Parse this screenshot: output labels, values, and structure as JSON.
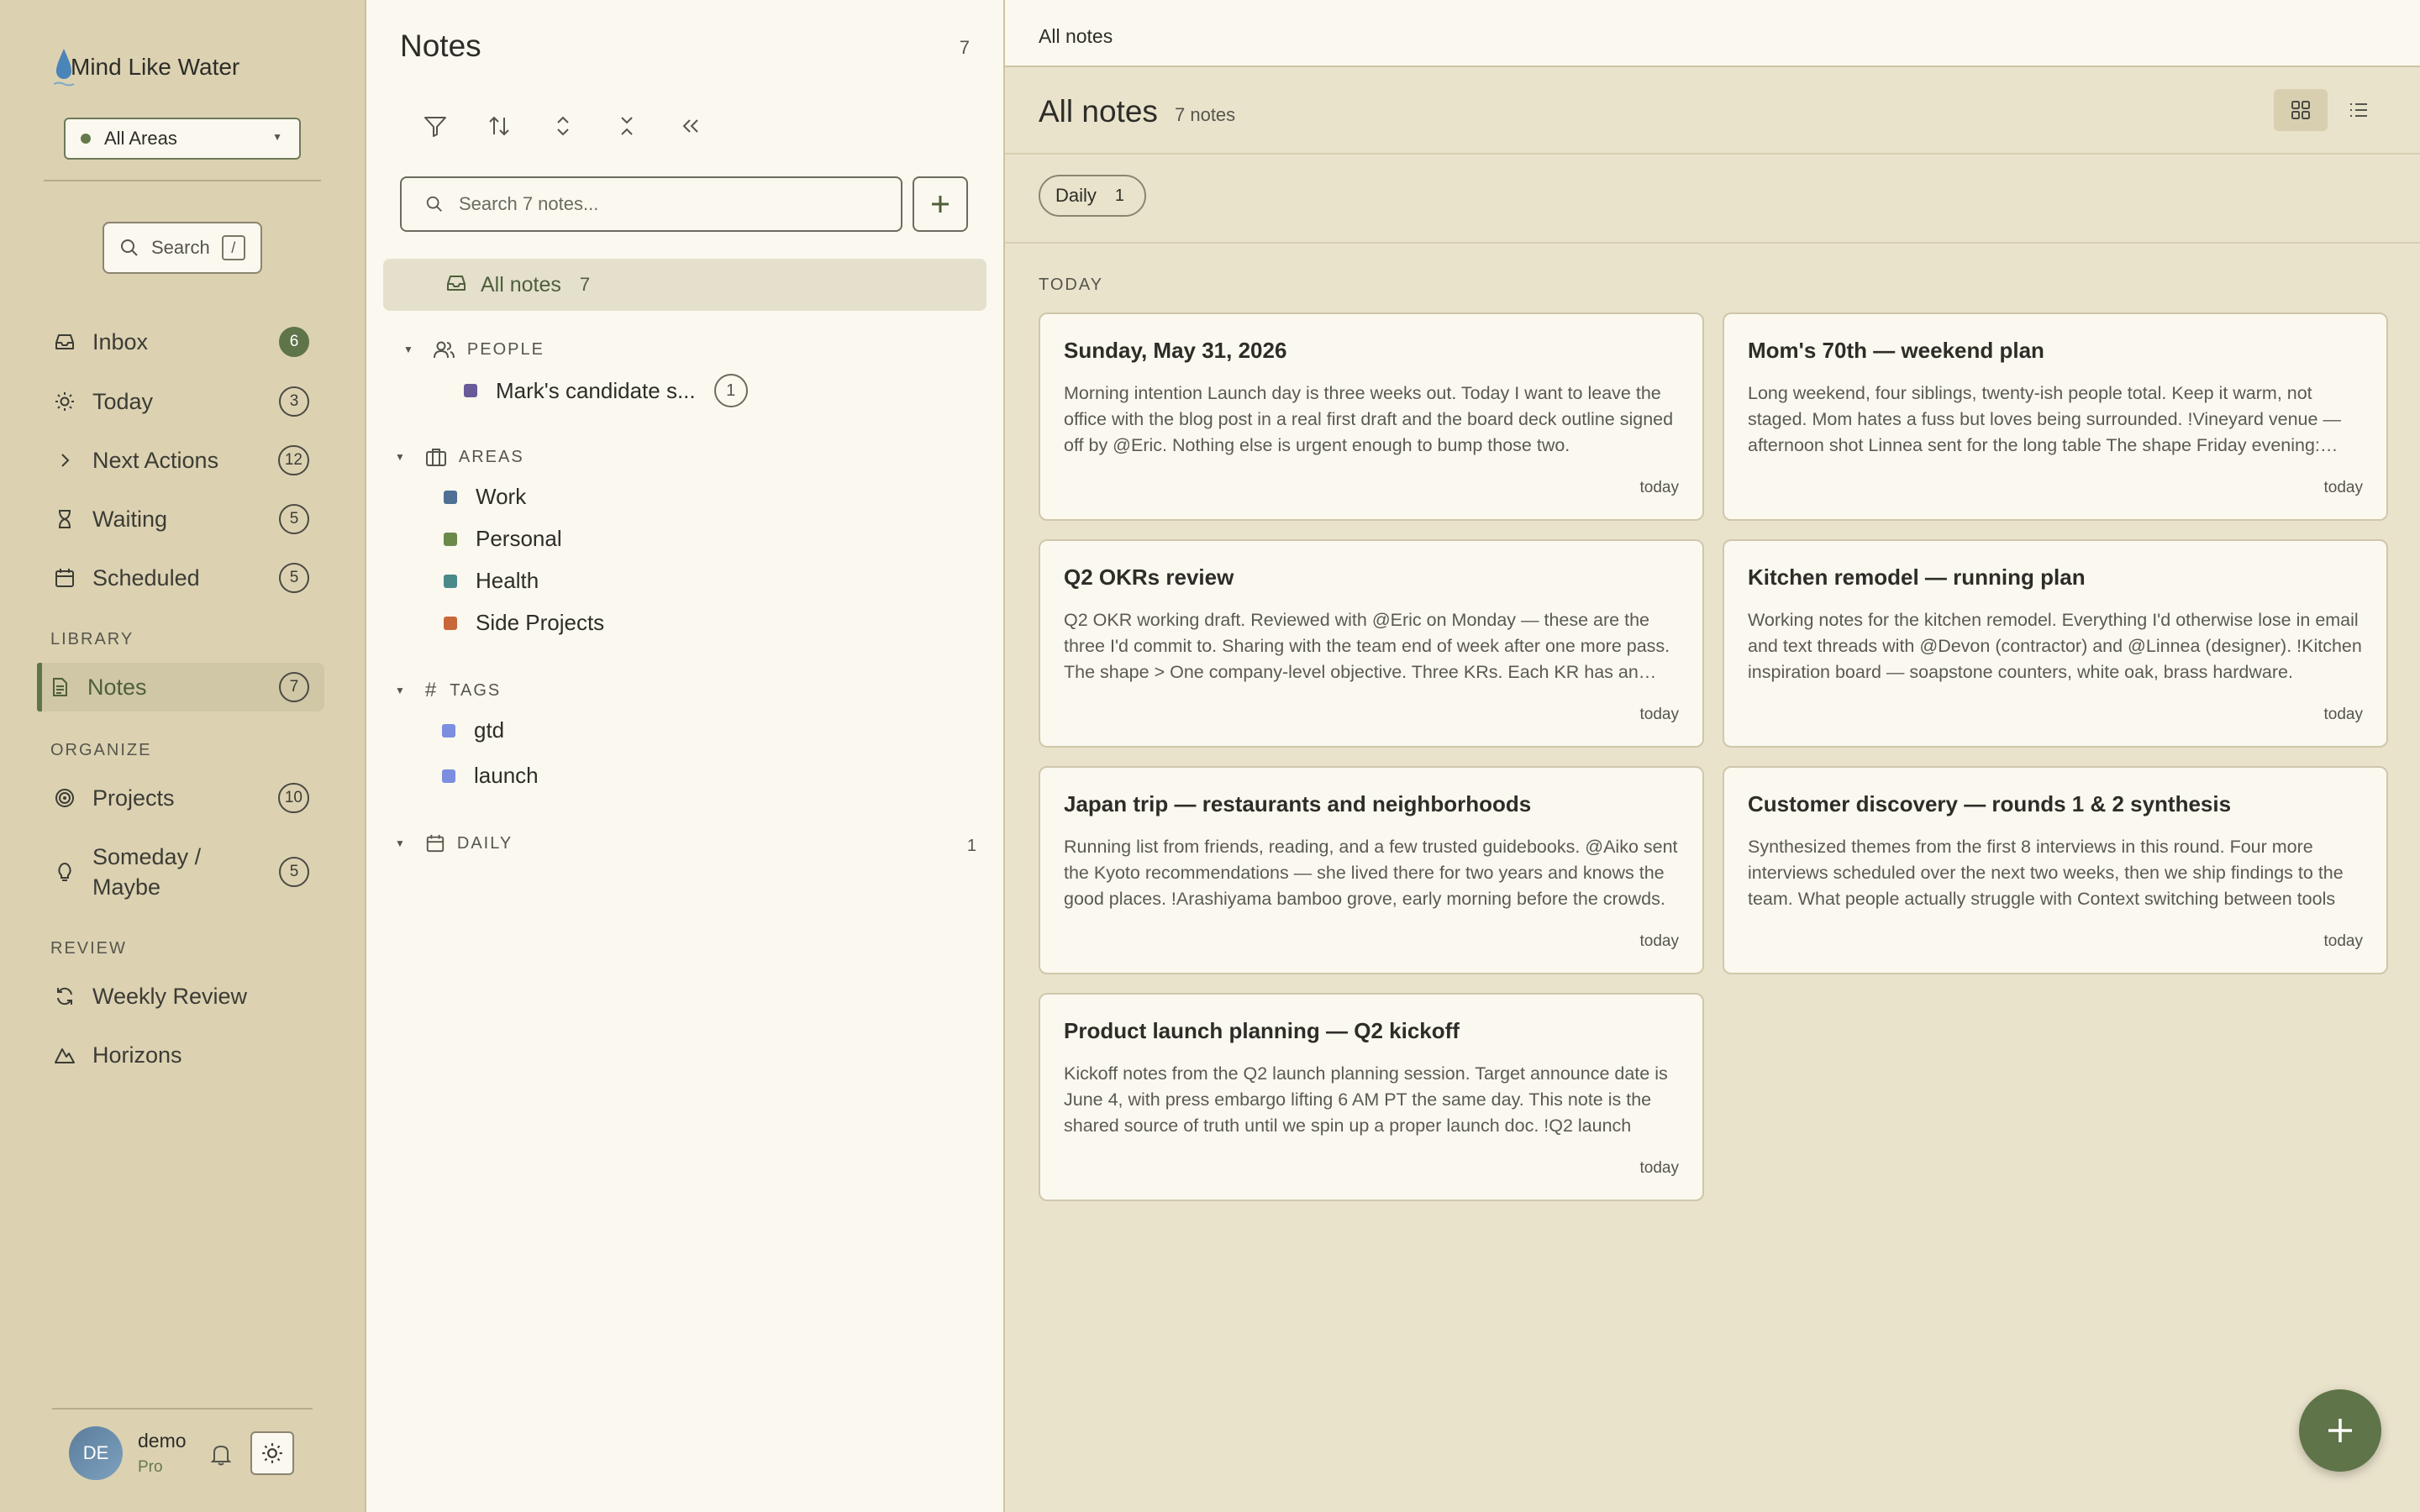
{
  "app": {
    "name": "Mind Like Water",
    "area_select": "All Areas",
    "search_label": "Search",
    "search_shortcut": "/",
    "accent_color": "#5f7448"
  },
  "sidebar": {
    "nav": [
      {
        "label": "Inbox",
        "count": "6",
        "icon": "inbox-icon"
      },
      {
        "label": "Today",
        "count": "3",
        "icon": "sun-icon"
      },
      {
        "label": "Next Actions",
        "count": "12",
        "icon": "chevron-right-icon"
      },
      {
        "label": "Waiting",
        "count": "5",
        "icon": "hourglass-icon"
      },
      {
        "label": "Scheduled",
        "count": "5",
        "icon": "calendar-icon"
      }
    ],
    "library_label": "LIBRARY",
    "library": [
      {
        "label": "Notes",
        "count": "7",
        "icon": "document-icon"
      }
    ],
    "organize_label": "ORGANIZE",
    "organize": [
      {
        "label": "Projects",
        "count": "10",
        "icon": "target-icon"
      },
      {
        "label": "Someday / Maybe",
        "count": "5",
        "icon": "lightbulb-icon"
      }
    ],
    "review_label": "REVIEW",
    "review": [
      {
        "label": "Weekly Review",
        "icon": "refresh-icon"
      },
      {
        "label": "Horizons",
        "icon": "mountain-icon"
      }
    ],
    "user": {
      "initials": "DE",
      "name": "demo",
      "plan": "Pro"
    }
  },
  "notes_panel": {
    "title": "Notes",
    "count": "7",
    "search_placeholder": "Search 7 notes...",
    "all_notes_label": "All notes",
    "all_notes_count": "7",
    "people_label": "PEOPLE",
    "people": [
      {
        "label": "Mark's candidate s...",
        "count": "1",
        "color": "#6a5a9a"
      }
    ],
    "areas_label": "AREAS",
    "areas": [
      {
        "label": "Work",
        "color": "#4f6f94"
      },
      {
        "label": "Personal",
        "color": "#6a8a4a"
      },
      {
        "label": "Health",
        "color": "#4a8a8a"
      },
      {
        "label": "Side Projects",
        "color": "#c8683a"
      }
    ],
    "tags_label": "TAGS",
    "tags": [
      {
        "label": "gtd",
        "color": "#7b8ee0"
      },
      {
        "label": "launch",
        "color": "#7b8ee0"
      }
    ],
    "daily_label": "DAILY",
    "daily_count": "1"
  },
  "main": {
    "breadcrumb": "All notes",
    "title": "All notes",
    "subtitle": "7 notes",
    "filter_chip": {
      "label": "Daily",
      "count": "1"
    },
    "group_label": "TODAY",
    "cards": [
      {
        "title": "Sunday, May 31, 2026",
        "excerpt": "Morning intention Launch day is three weeks out. Today I want to leave the office with the blog post in a real first draft and the board deck outline signed off by @Eric. Nothing else is urgent enough to bump those two.",
        "date": "today"
      },
      {
        "title": "Mom's 70th — weekend plan",
        "excerpt": "Long weekend, four siblings, twenty-ish people total. Keep it warm, not staged. Mom hates a fuss but loves being surrounded. !Vineyard venue — afternoon shot Linnea sent for the long table The shape Friday evening: arrivals and a casual dinner.",
        "date": "today"
      },
      {
        "title": "Q2 OKRs review",
        "excerpt": "Q2 OKR working draft. Reviewed with @Eric on Monday — these are the three I'd commit to. Sharing with the team end of week after one more pass. The shape > One company-level objective. Three KRs. Each KR has an owner.",
        "date": "today"
      },
      {
        "title": "Kitchen remodel — running plan",
        "excerpt": "Working notes for the kitchen remodel. Everything I'd otherwise lose in email and text threads with @Devon (contractor) and @Linnea (designer). !Kitchen inspiration board — soapstone counters, white oak, brass hardware.",
        "date": "today"
      },
      {
        "title": "Japan trip — restaurants and neighborhoods",
        "excerpt": "Running list from friends, reading, and a few trusted guidebooks. @Aiko sent the Kyoto recommendations — she lived there for two years and knows the good places. !Arashiyama bamboo grove, early morning before the crowds.",
        "date": "today"
      },
      {
        "title": "Customer discovery — rounds 1 & 2 synthesis",
        "excerpt": "Synthesized themes from the first 8 interviews in this round. Four more interviews scheduled over the next two weeks, then we ship findings to the team. What people actually struggle with Context switching between tools",
        "date": "today"
      },
      {
        "title": "Product launch planning — Q2 kickoff",
        "excerpt": "Kickoff notes from the Q2 launch planning session. Target announce date is June 4, with press embargo lifting 6 AM PT the same day. This note is the shared source of truth until we spin up a proper launch doc. !Q2 launch",
        "date": "today"
      }
    ]
  }
}
